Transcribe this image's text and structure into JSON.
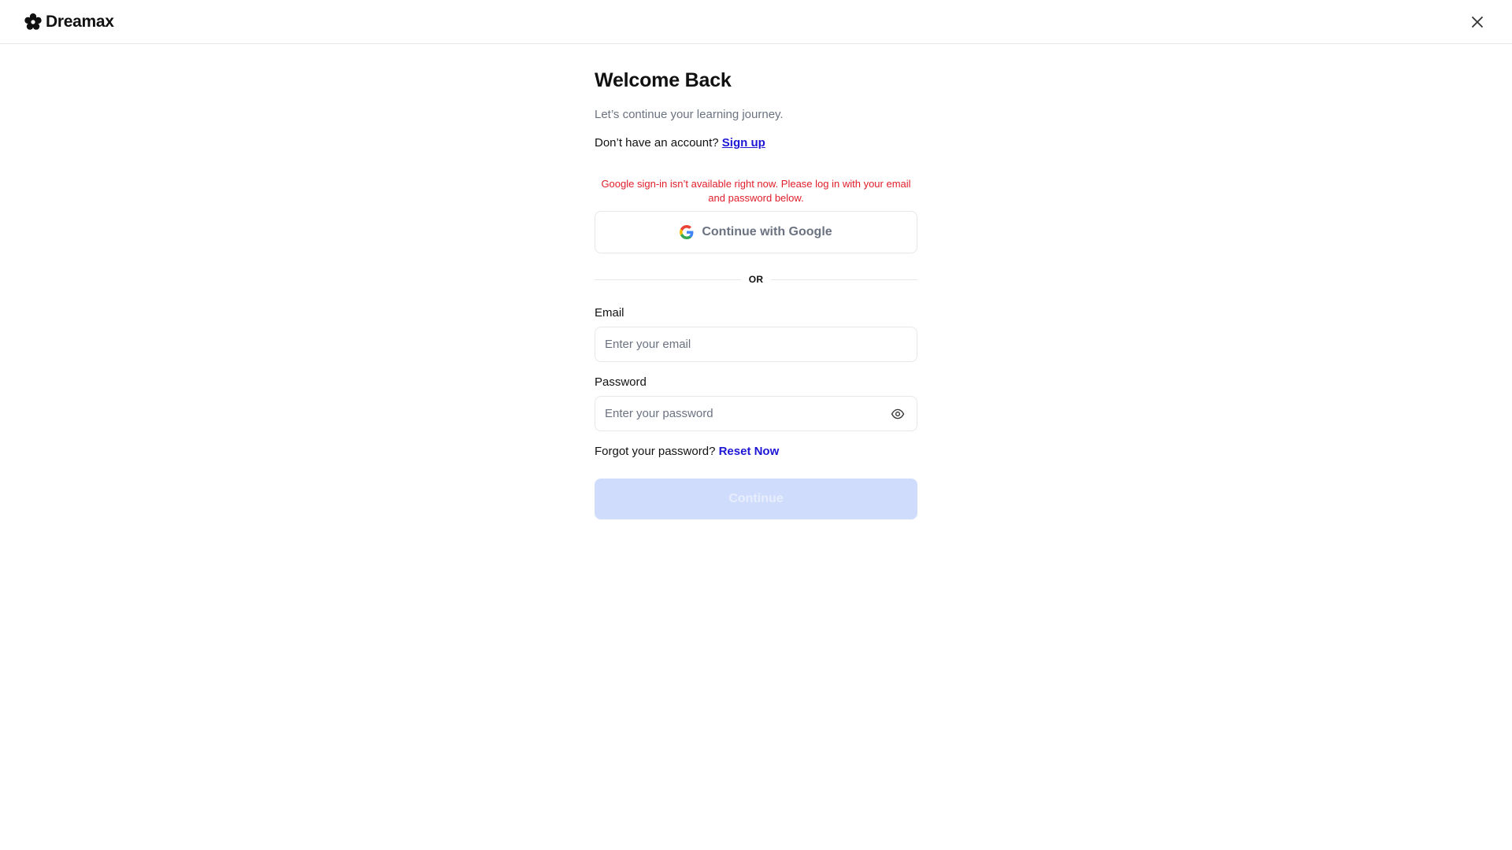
{
  "brand": {
    "name": "Dreamax",
    "logo_icon": "flower-logo-icon"
  },
  "header": {
    "close_icon": "close-icon"
  },
  "login": {
    "title": "Welcome Back",
    "subtitle": "Let’s continue your learning journey.",
    "signup_prompt": "Don’t have an account?",
    "signup_link": "Sign up",
    "error_message": "Google sign-in isn’t available right now. Please log in with your email and password below.",
    "google_button": "Continue with Google",
    "google_icon": "google-icon",
    "divider_text": "OR",
    "email": {
      "label": "Email",
      "placeholder": "Enter your email",
      "value": ""
    },
    "password": {
      "label": "Password",
      "placeholder": "Enter your password",
      "value": "",
      "toggle_icon": "eye-icon"
    },
    "forgot_prompt": "Forgot your password?",
    "reset_link": "Reset Now",
    "continue_button": "Continue",
    "continue_disabled": true
  },
  "colors": {
    "link": "#1d16d4",
    "error": "#e11d2a",
    "button_disabled_bg": "#cfdcfb",
    "border": "#e5e7eb",
    "muted_text": "#6b7280"
  }
}
